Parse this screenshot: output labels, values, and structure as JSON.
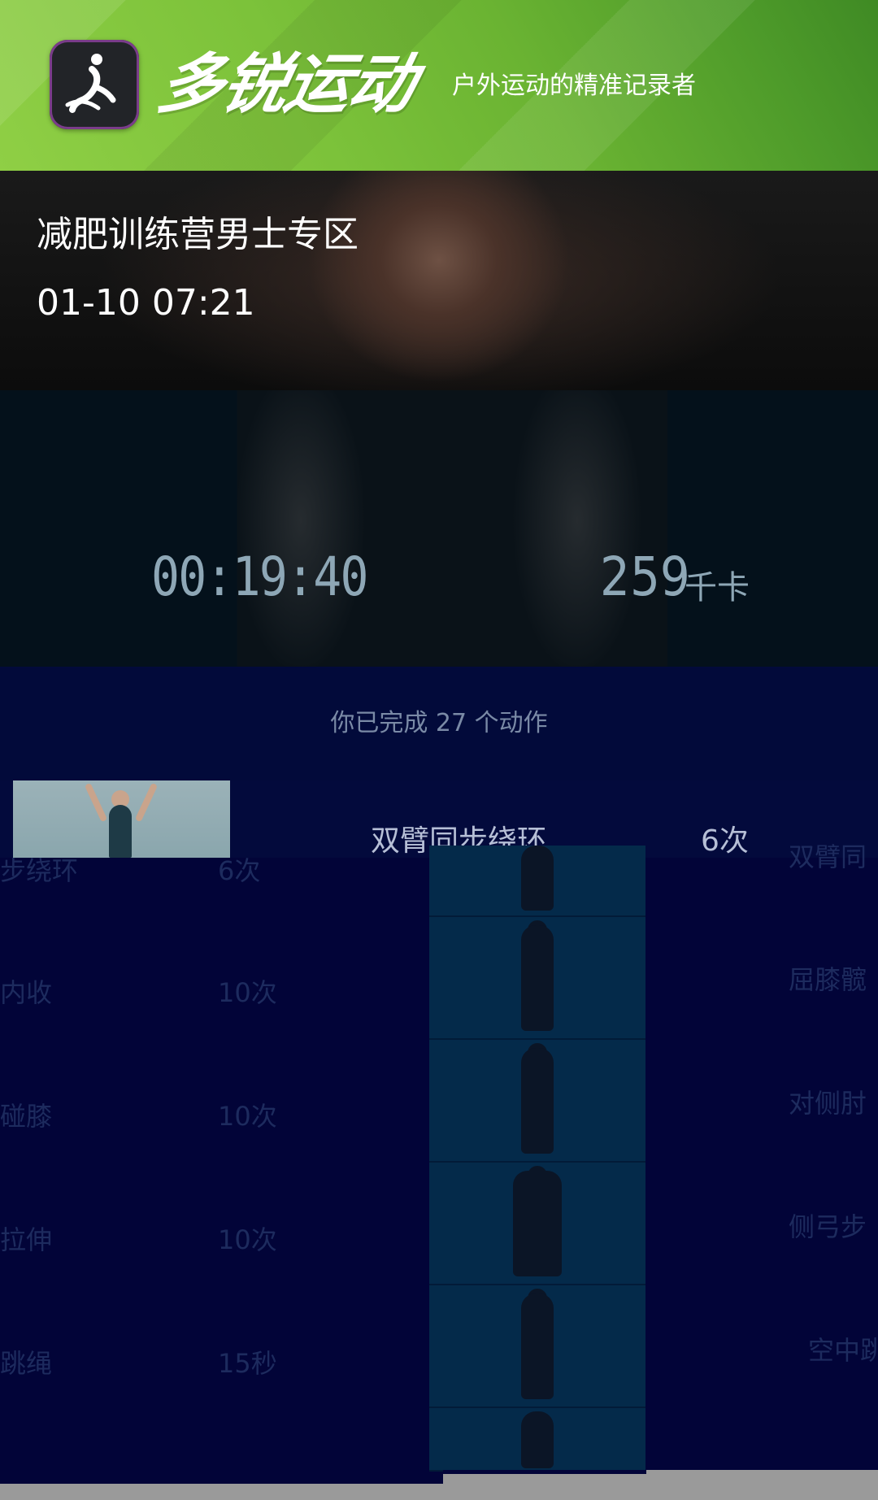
{
  "header": {
    "app_icon": "app-logo-runner-icon",
    "brand_name": "多锐运动",
    "slogan": "户外运动的精准记录者"
  },
  "workout": {
    "title": "减肥训练营男士专区",
    "datetime": "01-10 07:21",
    "duration": "00:19:40",
    "calories": "259",
    "calories_unit": "千卡",
    "completed_text": "你已完成 27 个动作"
  },
  "exercise_header": {
    "name": "双臂同步绕环",
    "count": "6次"
  },
  "left_column": [
    {
      "name": "步绕环",
      "count": "6次"
    },
    {
      "name": "内收",
      "count": "10次"
    },
    {
      "name": "碰膝",
      "count": "10次"
    },
    {
      "name": "拉伸",
      "count": "10次"
    },
    {
      "name": "跳绳",
      "count": "15秒"
    }
  ],
  "right_column": [
    {
      "name": "双臂同"
    },
    {
      "name": "屈膝髋"
    },
    {
      "name": "对侧肘"
    },
    {
      "name": "侧弓步"
    },
    {
      "name": "空中跳"
    }
  ],
  "colors": {
    "header_green": "#7cc23a",
    "stat_text": "#8ea7b6",
    "list_bg": "#020438"
  }
}
